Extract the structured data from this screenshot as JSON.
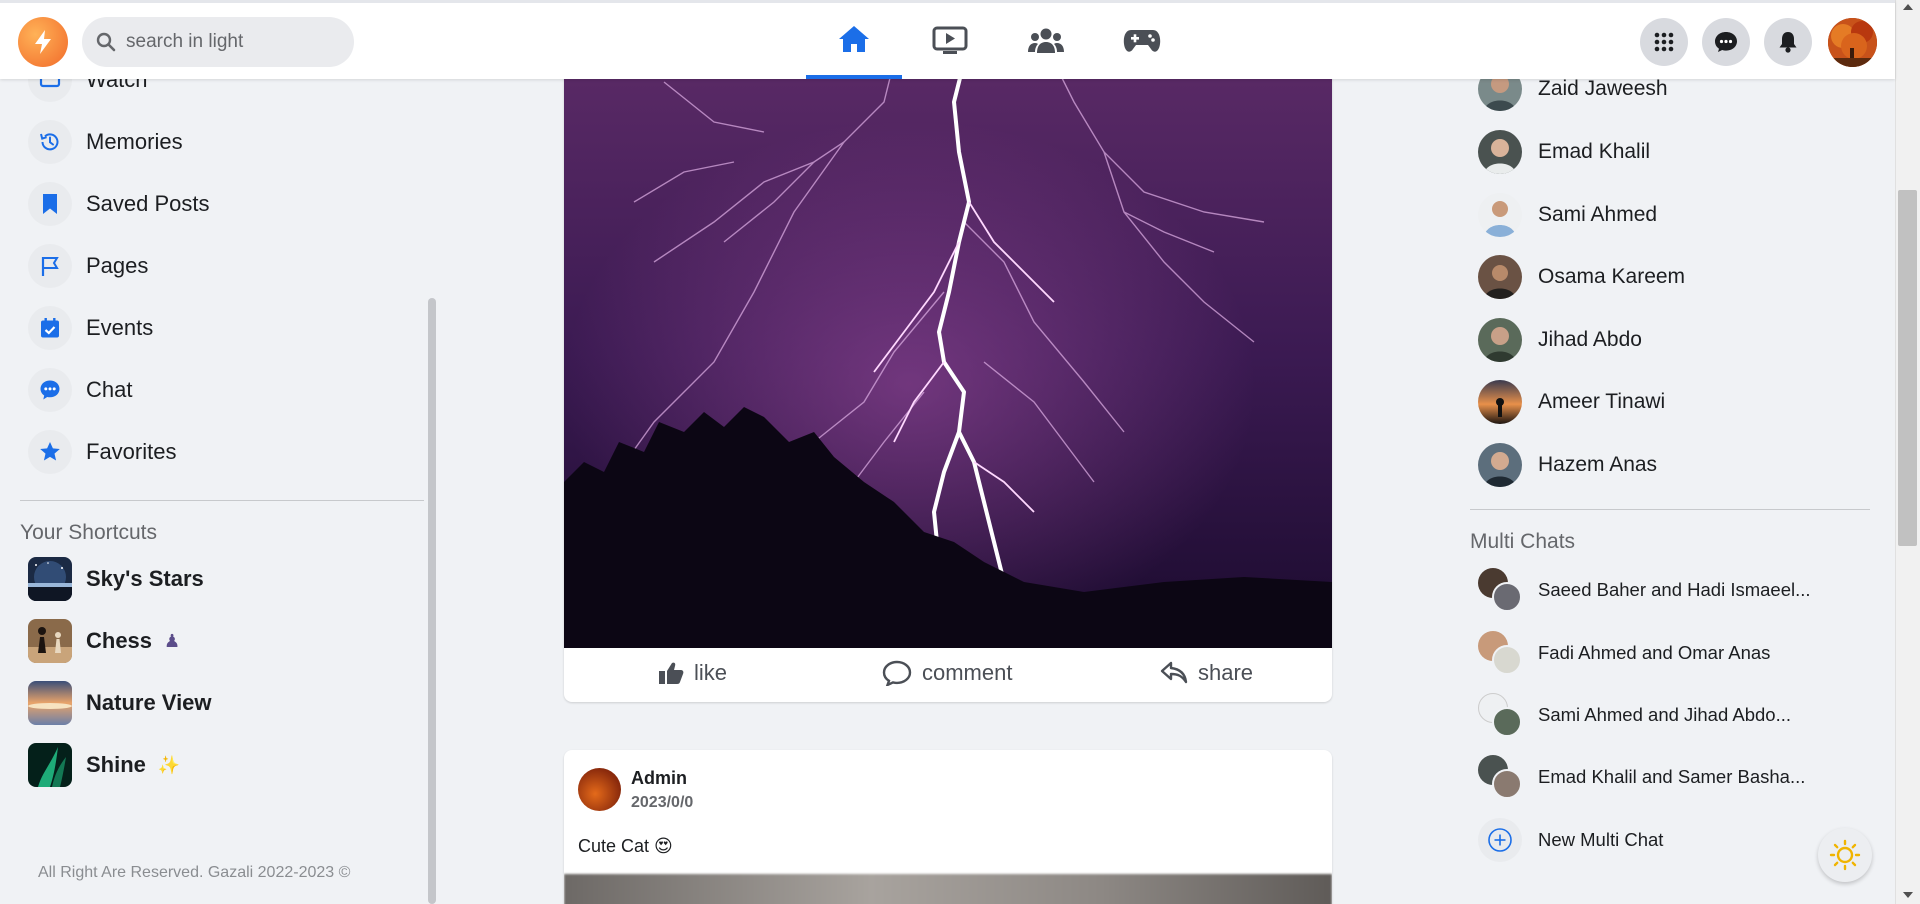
{
  "topbar": {
    "search_placeholder": "search in light"
  },
  "left_menu": [
    {
      "label": "Watch",
      "icon": "watch-icon"
    },
    {
      "label": "Memories",
      "icon": "clock-history-icon"
    },
    {
      "label": "Saved Posts",
      "icon": "bookmark-icon"
    },
    {
      "label": "Pages",
      "icon": "flag-icon"
    },
    {
      "label": "Events",
      "icon": "calendar-icon"
    },
    {
      "label": "Chat",
      "icon": "chat-bubble-icon"
    },
    {
      "label": "Favorites",
      "icon": "star-icon"
    }
  ],
  "shortcuts": {
    "title": "Your Shortcuts",
    "items": [
      {
        "label": "Sky's Stars",
        "emoji": ""
      },
      {
        "label": "Chess",
        "emoji": "♟"
      },
      {
        "label": "Nature View",
        "emoji": ""
      },
      {
        "label": "Shine",
        "emoji": "✨"
      }
    ]
  },
  "footer": "All Right Are Reserved. Gazali 2022-2023 ©",
  "post1": {
    "actions": {
      "like": "like",
      "comment": "comment",
      "share": "share"
    }
  },
  "post2": {
    "author": "Admin",
    "date": "2023/0/0",
    "caption": "Cute Cat 😍"
  },
  "contacts": [
    "Zaid Jaweesh",
    "Emad Khalil",
    "Sami Ahmed",
    "Osama Kareem",
    "Jihad Abdo",
    "Ameer Tinawi",
    "Hazem Anas"
  ],
  "multi_chats": {
    "title": "Multi Chats",
    "items": [
      "Saeed Baher and Hadi Ismaeel...",
      "Fadi Ahmed and Omar Anas",
      "Sami Ahmed and Jihad Abdo...",
      "Emad Khalil and Samer Basha..."
    ],
    "new_label": "New Multi Chat"
  },
  "colors": {
    "accent": "#1b6ee8",
    "background": "#f0f2f5",
    "logo": "#f16a2a"
  }
}
